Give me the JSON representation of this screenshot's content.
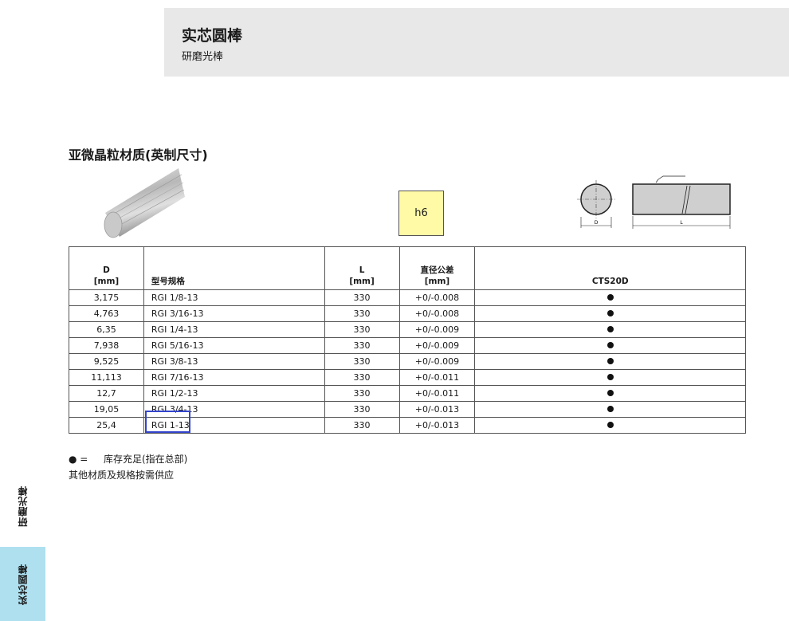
{
  "header": {
    "title": "实芯圆棒",
    "subtitle": "研磨光棒"
  },
  "section": {
    "title": "亚微晶粒材质(英制尺寸)"
  },
  "tolerance_class": "h6",
  "drawing": {
    "d_label": "D",
    "l_label": "L"
  },
  "table": {
    "headers": {
      "d": "D",
      "d_unit": "[mm]",
      "model": "型号规格",
      "l": "L",
      "l_unit": "[mm]",
      "tol": "直径公差",
      "tol_unit": "[mm]",
      "grade": "CTS20D"
    },
    "rows": [
      {
        "d": "3,175",
        "model": "RGI 1/8-13",
        "l": "330",
        "tol": "+0/-0.008"
      },
      {
        "d": "4,763",
        "model": "RGI 3/16-13",
        "l": "330",
        "tol": "+0/-0.008"
      },
      {
        "d": "6,35",
        "model": "RGI 1/4-13",
        "l": "330",
        "tol": "+0/-0.009"
      },
      {
        "d": "7,938",
        "model": "RGI 5/16-13",
        "l": "330",
        "tol": "+0/-0.009"
      },
      {
        "d": "9,525",
        "model": "RGI 3/8-13",
        "l": "330",
        "tol": "+0/-0.009"
      },
      {
        "d": "11,113",
        "model": "RGI 7/16-13",
        "l": "330",
        "tol": "+0/-0.011"
      },
      {
        "d": "12,7",
        "model": "RGI 1/2-13",
        "l": "330",
        "tol": "+0/-0.011"
      },
      {
        "d": "19,05",
        "model": "RGI 3/4-13",
        "l": "330",
        "tol": "+0/-0.013"
      },
      {
        "d": "25,4",
        "model": "RGI 1-13",
        "l": "330",
        "tol": "+0/-0.013"
      }
    ]
  },
  "legend": {
    "symbol": "● =",
    "stock_text": "库存充足(指在总部)",
    "note": "其他材质及规格按需供应"
  },
  "side_tabs": {
    "tab1": "研磨光棒",
    "tab2": "实芯圆棒"
  },
  "colors": {
    "header_bg": "#e8e8e8",
    "tolerance_bg": "#fffaa6",
    "active_tab": "#aee0f0",
    "highlight": "#3344cc"
  }
}
